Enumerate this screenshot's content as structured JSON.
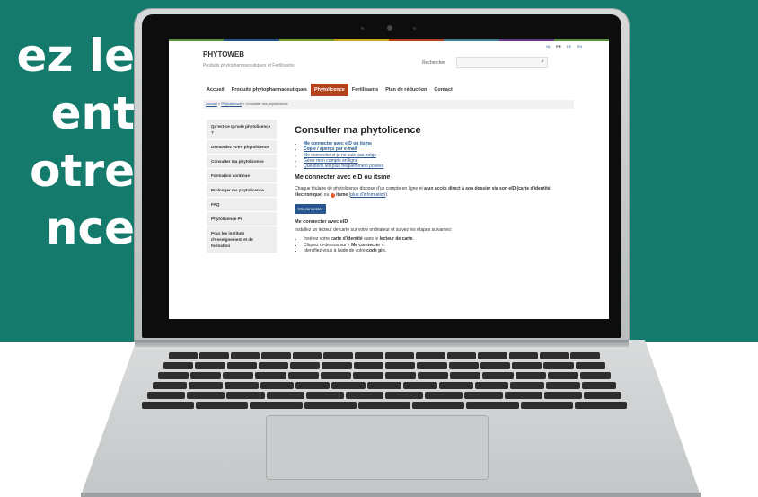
{
  "headline": {
    "lines": [
      "ez le",
      "ent",
      "otre",
      "nce"
    ]
  },
  "site": {
    "brand": "PHYTOWEB",
    "tagline": "Produits phytopharmaceutiques et Fertilisants",
    "languages": [
      "NL",
      "FR",
      "DE",
      "EN"
    ],
    "active_language": "FR",
    "search_label": "Rechercher"
  },
  "nav": {
    "items": [
      "Accueil",
      "Produits phytopharmaceutiques",
      "Phytolicence",
      "Fertilisants",
      "Plan de réduction",
      "Contact"
    ],
    "active": "Phytolicence"
  },
  "breadcrumb": {
    "home": "Accueil",
    "section": "Phytolicence",
    "current": "Consulter ma phytolicence",
    "sep": "»"
  },
  "sidebar": {
    "items": [
      "Qu'est-ce qu'une phytolicence ?",
      "Demandez votre phytolicence",
      "Consulter ma phytolicence",
      "Formation continue",
      "Prolonger ma phytolicence",
      "FAQ",
      "Phytolicence Ps",
      "Pour les instituts d'enseignement et de formation"
    ]
  },
  "main": {
    "title": "Consulter ma phytolicence",
    "links": [
      "Me connecter avec eID ou itsme",
      "Copie / aperçu par e-mail",
      "Me connecter si je ne suis pas belge",
      "Gérer mon compte en ligne",
      "Questions les plus fréquemment posées"
    ],
    "section_title": "Me connecter avec eID ou itsme",
    "para_1": "Chaque titulaire de phytolicence dispose d'un compte en ligne et",
    "para_bold": "a un accès direct à son dossier via son eID (carte d'identité électronique)",
    "para_or": "ou",
    "para_itsme": "itsme",
    "para_link": "plus d'information",
    "button": "Me connecter",
    "sub_title": "Me connecter avec eID",
    "sub_para": "Installez un lecteur de carte sur votre ordinateur et suivez les étapes suivantes:",
    "step_1_a": "Insérez votre",
    "step_1_b": "carte d'identité",
    "step_1_c": "dans le",
    "step_1_d": "lecteur de carte",
    "step_2_a": "Cliquez ci-dessus sur «",
    "step_2_b": "Me connecter",
    "step_2_c": "».",
    "step_3_a": "Identifiez-vous à l'aide de votre",
    "step_3_b": "code pin"
  },
  "colors": {
    "background": "#137a6c",
    "nav_active": "#b5411c",
    "link": "#27568f",
    "button": "#27568f"
  }
}
